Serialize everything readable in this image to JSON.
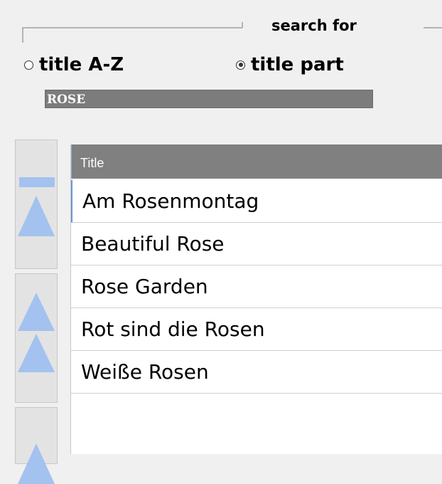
{
  "search_group": {
    "title": "search for",
    "options": [
      {
        "label": "title A-Z",
        "selected": false
      },
      {
        "label": "title part",
        "selected": true
      }
    ],
    "input_value": "ROSE"
  },
  "list": {
    "header": "Title",
    "items": [
      "Am Rosenmontag",
      "Beautiful Rose",
      "Rose Garden",
      "Rot sind die Rosen",
      "Weiße Rosen"
    ]
  },
  "nav_buttons": [
    {
      "icon": "scroll-to-top-icon"
    },
    {
      "icon": "page-up-icon"
    },
    {
      "icon": "scroll-up-icon"
    }
  ],
  "colors": {
    "accent": "#a4c2ef",
    "header_bg": "#808080",
    "input_bg": "#7c7c7c"
  }
}
